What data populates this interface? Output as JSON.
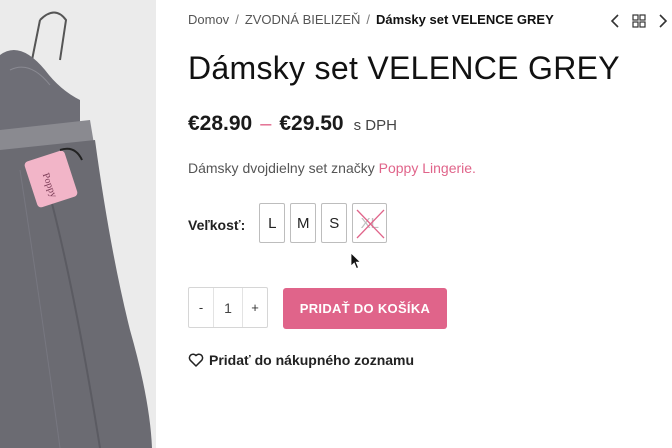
{
  "breadcrumb": {
    "home": "Domov",
    "category": "ZVODNÁ BIELIZEŇ",
    "current": "Dámsky set VELENCE GREY",
    "separator": "/"
  },
  "nav": {
    "icons": [
      "chevron-left-icon",
      "grid-icon",
      "chevron-right-icon"
    ]
  },
  "product": {
    "title": "Dámsky set VELENCE GREY",
    "price_min": "€28.90",
    "price_dash": "–",
    "price_max": "€29.50",
    "tax_note": "s DPH",
    "description_prefix": "Dámsky dvojdielny set značky",
    "brand_link": "Poppy Lingerie."
  },
  "sizes": {
    "label": "Veľkosť:",
    "options": [
      {
        "label": "L",
        "available": true
      },
      {
        "label": "M",
        "available": true
      },
      {
        "label": "S",
        "available": true
      },
      {
        "label": "XL",
        "available": false
      }
    ]
  },
  "cart": {
    "minus": "-",
    "quantity": "1",
    "plus": "+",
    "add_label": "PRIDAŤ DO KOŠÍKA"
  },
  "wishlist": {
    "label": "Pridať do nákupného zoznamu"
  },
  "colors": {
    "accent": "#e0648a",
    "text": "#222222"
  }
}
